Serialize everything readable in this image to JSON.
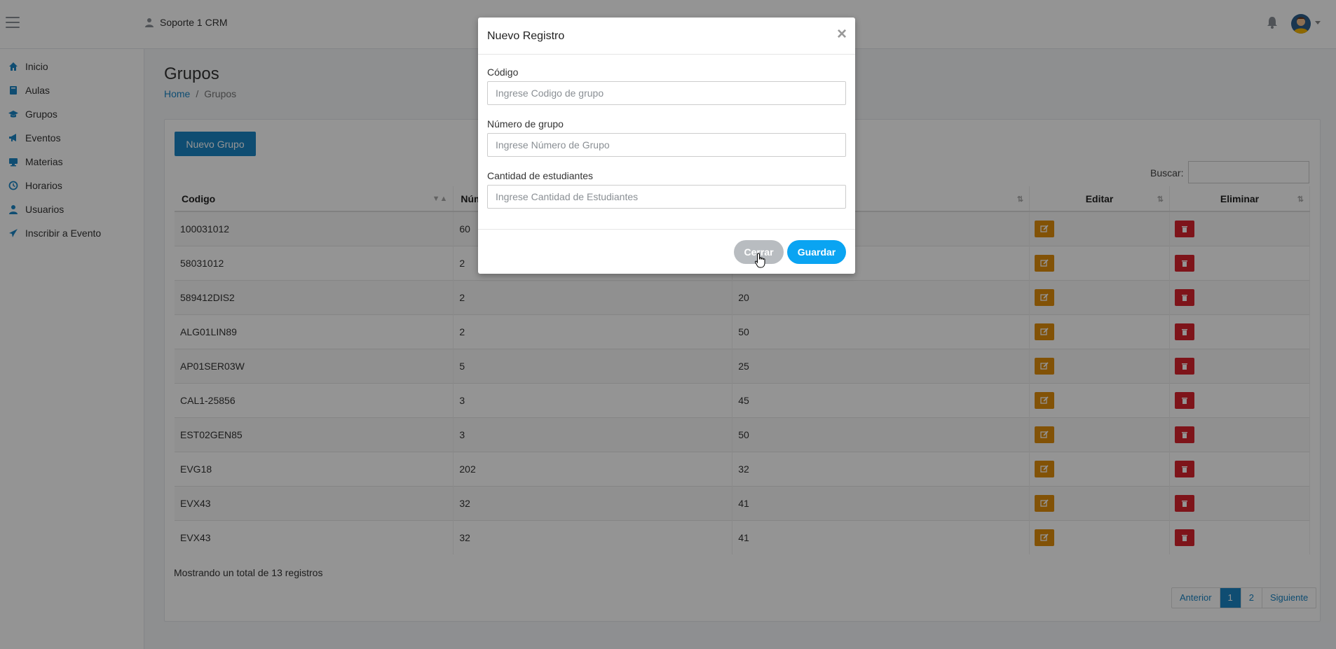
{
  "header": {
    "user_label": "Soporte 1 CRM"
  },
  "sidebar": {
    "items": [
      {
        "label": "Inicio",
        "icon": "home-icon"
      },
      {
        "label": "Aulas",
        "icon": "book-icon"
      },
      {
        "label": "Grupos",
        "icon": "graduation-cap-icon"
      },
      {
        "label": "Eventos",
        "icon": "bullhorn-icon"
      },
      {
        "label": "Materias",
        "icon": "desktop-icon"
      },
      {
        "label": "Horarios",
        "icon": "clock-icon"
      },
      {
        "label": "Usuarios",
        "icon": "user-icon"
      },
      {
        "label": "Inscribir a Evento",
        "icon": "send-icon"
      }
    ]
  },
  "page": {
    "title": "Grupos",
    "breadcrumb": {
      "home": "Home",
      "separator": "/",
      "current": "Grupos"
    },
    "new_button": "Nuevo Grupo",
    "search_label": "Buscar:"
  },
  "table": {
    "headers": {
      "codigo": "Codigo",
      "numero": "Núm",
      "editar": "Editar",
      "eliminar": "Eliminar"
    },
    "rows": [
      [
        "100031012",
        "60",
        ""
      ],
      [
        "58031012",
        "2",
        ""
      ],
      [
        "589412DIS2",
        "2",
        "20"
      ],
      [
        "ALG01LIN89",
        "2",
        "50"
      ],
      [
        "AP01SER03W",
        "5",
        "25"
      ],
      [
        "CAL1-25856",
        "3",
        "45"
      ],
      [
        "EST02GEN85",
        "3",
        "50"
      ],
      [
        "EVG18",
        "202",
        "32"
      ],
      [
        "EVX43",
        "32",
        "41"
      ],
      [
        "EVX43",
        "32",
        "41"
      ]
    ],
    "footer_info": "Mostrando un total de 13 registros",
    "pagination": {
      "prev": "Anterior",
      "pages": [
        "1",
        "2"
      ],
      "next": "Siguiente",
      "active": "1"
    }
  },
  "modal": {
    "title": "Nuevo Registro",
    "close_symbol": "×",
    "fields": [
      {
        "label": "Código",
        "placeholder": "Ingrese Codigo de grupo"
      },
      {
        "label": "Número de grupo",
        "placeholder": "Ingrese Número de Grupo"
      },
      {
        "label": "Cantidad de estudiantes",
        "placeholder": "Ingrese Cantidad de Estudiantes"
      }
    ],
    "cancel_label": "Cerrar",
    "save_label": "Guardar"
  },
  "colors": {
    "primary": "#1a85c5",
    "save": "#0aa4f2",
    "edit": "#e08e0b",
    "delete": "#d9232d"
  }
}
